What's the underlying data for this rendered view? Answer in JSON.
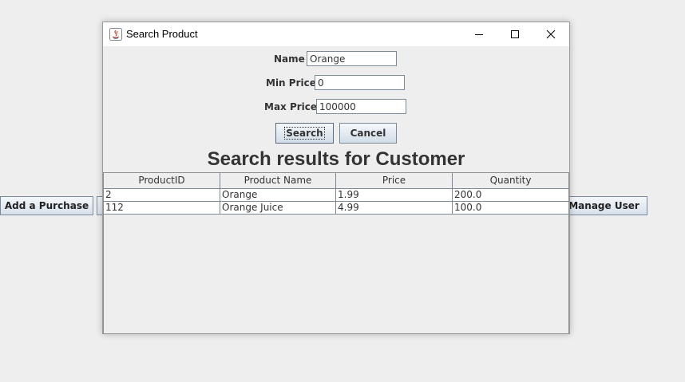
{
  "background": {
    "add_purchase_label": "Add a Purchase",
    "manage_user_label": "Manage User"
  },
  "dialog": {
    "title": "Search Product",
    "window_controls": {
      "minimize": "minimize-icon",
      "maximize": "maximize-icon",
      "close": "close-icon"
    },
    "form": {
      "name_label": "Name",
      "name_value": "Orange",
      "min_price_label": "Min Price",
      "min_price_value": "0",
      "max_price_label": "Max Price",
      "max_price_value": "100000",
      "search_label": "Search",
      "cancel_label": "Cancel"
    },
    "results_heading": "Search results for Customer",
    "table": {
      "columns": [
        "ProductID",
        "Product Name",
        "Price",
        "Quantity"
      ],
      "rows": [
        [
          "2",
          "Orange",
          "1.99",
          "200.0"
        ],
        [
          "112",
          "Orange Juice",
          "4.99",
          "100.0"
        ]
      ]
    }
  }
}
